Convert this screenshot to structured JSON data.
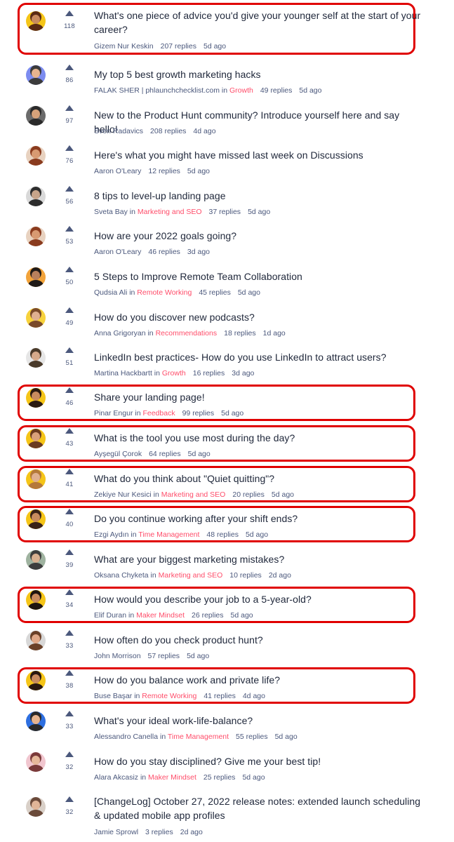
{
  "discussions": [
    {
      "title": "What's one piece of advice you'd give your younger self at the start of your career?",
      "author": "Gizem Nur Keskin",
      "topic": "",
      "replies": "207 replies",
      "age": "5d ago",
      "votes": "118",
      "avatar_bg": "#f5c518",
      "avatar_skin": "#c98b5e",
      "avatar_hair": "#5a2a14",
      "highlighted": true
    },
    {
      "title": "My top 5 best growth marketing hacks",
      "author": "FALAK SHER | phlaunchchecklist.com",
      "topic": "Growth",
      "replies": "49 replies",
      "age": "5d ago",
      "votes": "86",
      "avatar_bg": "#7c8cf0",
      "avatar_skin": "#e6b48f",
      "avatar_hair": "#3b3b3b",
      "highlighted": false
    },
    {
      "title": "New to the Product Hunt community? Introduce yourself here and say hello!",
      "author": "Sven Radavics",
      "topic": "",
      "replies": "208 replies",
      "age": "4d ago",
      "votes": "97",
      "avatar_bg": "#6b6b6b",
      "avatar_skin": "#d6a27a",
      "avatar_hair": "#2a2a2a",
      "highlighted": false
    },
    {
      "title": "Here's what you might have missed last week on Discussions",
      "author": "Aaron O'Leary",
      "topic": "",
      "replies": "12 replies",
      "age": "5d ago",
      "votes": "76",
      "avatar_bg": "#e8d2c0",
      "avatar_skin": "#d89a72",
      "avatar_hair": "#8a3b1e",
      "highlighted": false
    },
    {
      "title": "8 tips to level-up landing page",
      "author": "Sveta Bay",
      "topic": "Marketing and SEO",
      "replies": "37 replies",
      "age": "5d ago",
      "votes": "56",
      "avatar_bg": "#d9d9d9",
      "avatar_skin": "#c7a48a",
      "avatar_hair": "#2d2d2d",
      "highlighted": false
    },
    {
      "title": "How are your 2022 goals going?",
      "author": "Aaron O'Leary",
      "topic": "",
      "replies": "46 replies",
      "age": "3d ago",
      "votes": "53",
      "avatar_bg": "#e8d2c0",
      "avatar_skin": "#d89a72",
      "avatar_hair": "#8a3b1e",
      "highlighted": false
    },
    {
      "title": "5 Steps to Improve Remote Team Collaboration",
      "author": "Qudsia Ali",
      "topic": "Remote Working",
      "replies": "45 replies",
      "age": "5d ago",
      "votes": "50",
      "avatar_bg": "#f2a33a",
      "avatar_skin": "#b9805c",
      "avatar_hair": "#1f1a18",
      "highlighted": false
    },
    {
      "title": "How do you discover new podcasts?",
      "author": "Anna Grigoryan",
      "topic": "Recommendations",
      "replies": "18 replies",
      "age": "1d ago",
      "votes": "49",
      "avatar_bg": "#f7d23c",
      "avatar_skin": "#e0b090",
      "avatar_hair": "#7a4a2a",
      "highlighted": false
    },
    {
      "title": "LinkedIn best practices- How do you use LinkedIn to attract users?",
      "author": "Martina Hackbartt",
      "topic": "Growth",
      "replies": "16 replies",
      "age": "3d ago",
      "votes": "51",
      "avatar_bg": "#e6e6e6",
      "avatar_skin": "#d6a98a",
      "avatar_hair": "#4a3a2a",
      "highlighted": false
    },
    {
      "title": "Share your landing page!",
      "author": "Pinar Engur",
      "topic": "Feedback",
      "replies": "99 replies",
      "age": "5d ago",
      "votes": "46",
      "avatar_bg": "#f5c518",
      "avatar_skin": "#c98b5e",
      "avatar_hair": "#2a1a12",
      "highlighted": true
    },
    {
      "title": "What is the tool you use most during the day?",
      "author": "Ayşegül Çorok",
      "topic": "",
      "replies": "64 replies",
      "age": "5d ago",
      "votes": "43",
      "avatar_bg": "#f5c518",
      "avatar_skin": "#d9a07a",
      "avatar_hair": "#6a3a20",
      "highlighted": true
    },
    {
      "title": "What do you think about \"Quiet quitting\"?",
      "author": "Zekiye Nur Kesici",
      "topic": "Marketing and SEO",
      "replies": "20 replies",
      "age": "5d ago",
      "votes": "41",
      "avatar_bg": "#f5c518",
      "avatar_skin": "#e0b090",
      "avatar_hair": "#b5793a",
      "highlighted": true
    },
    {
      "title": "Do you continue working after your shift ends?",
      "author": "Ezgi Aydın",
      "topic": "Time Management",
      "replies": "48 replies",
      "age": "5d ago",
      "votes": "40",
      "avatar_bg": "#f5c518",
      "avatar_skin": "#c98b5e",
      "avatar_hair": "#3a2218",
      "highlighted": true
    },
    {
      "title": "What are your biggest marketing mistakes?",
      "author": "Oksana Chyketa",
      "topic": "Marketing and SEO",
      "replies": "10 replies",
      "age": "2d ago",
      "votes": "39",
      "avatar_bg": "#9fb3a0",
      "avatar_skin": "#d8b090",
      "avatar_hair": "#3d3d3d",
      "highlighted": false
    },
    {
      "title": "How would you describe your job to a 5-year-old?",
      "author": "Elif Duran",
      "topic": "Maker Mindset",
      "replies": "26 replies",
      "age": "5d ago",
      "votes": "34",
      "avatar_bg": "#f5c518",
      "avatar_skin": "#c98b5e",
      "avatar_hair": "#1f1410",
      "highlighted": true
    },
    {
      "title": "How often do you check product hunt?",
      "author": "John Morrison",
      "topic": "",
      "replies": "57 replies",
      "age": "5d ago",
      "votes": "33",
      "avatar_bg": "#d8d8d8",
      "avatar_skin": "#e0a888",
      "avatar_hair": "#6a4028",
      "highlighted": false
    },
    {
      "title": "How do you balance work and private life?",
      "author": "Buse Başar",
      "topic": "Remote Working",
      "replies": "41 replies",
      "age": "4d ago",
      "votes": "38",
      "avatar_bg": "#f5c518",
      "avatar_skin": "#c98b5e",
      "avatar_hair": "#2a1810",
      "highlighted": true
    },
    {
      "title": "What's your ideal work-life-balance?",
      "author": "Alessandro Canella",
      "topic": "Time Management",
      "replies": "55 replies",
      "age": "5d ago",
      "votes": "33",
      "avatar_bg": "#2e6fe0",
      "avatar_skin": "#e6b48f",
      "avatar_hair": "#2a2a2a",
      "highlighted": false
    },
    {
      "title": "How do you stay disciplined? Give me your best tip!",
      "author": "Alara Akcasiz",
      "topic": "Maker Mindset",
      "replies": "25 replies",
      "age": "5d ago",
      "votes": "32",
      "avatar_bg": "#f1c6cf",
      "avatar_skin": "#e6b89a",
      "avatar_hair": "#7a3a3a",
      "highlighted": false
    },
    {
      "title": "[ChangeLog] October 27, 2022 release notes: extended launch scheduling & updated mobile app profiles",
      "author": "Jamie Sprowl",
      "topic": "",
      "replies": "3 replies",
      "age": "2d ago",
      "votes": "32",
      "avatar_bg": "#d9d0c8",
      "avatar_skin": "#e0b598",
      "avatar_hair": "#6a4a3a",
      "highlighted": false
    }
  ],
  "labels": {
    "in": "in",
    "upvote_icon": "upvote-arrow-icon"
  },
  "colors": {
    "topic": "#ff4d6a",
    "highlight": "#e00000",
    "text": "#21293c",
    "muted": "#4b587c"
  }
}
